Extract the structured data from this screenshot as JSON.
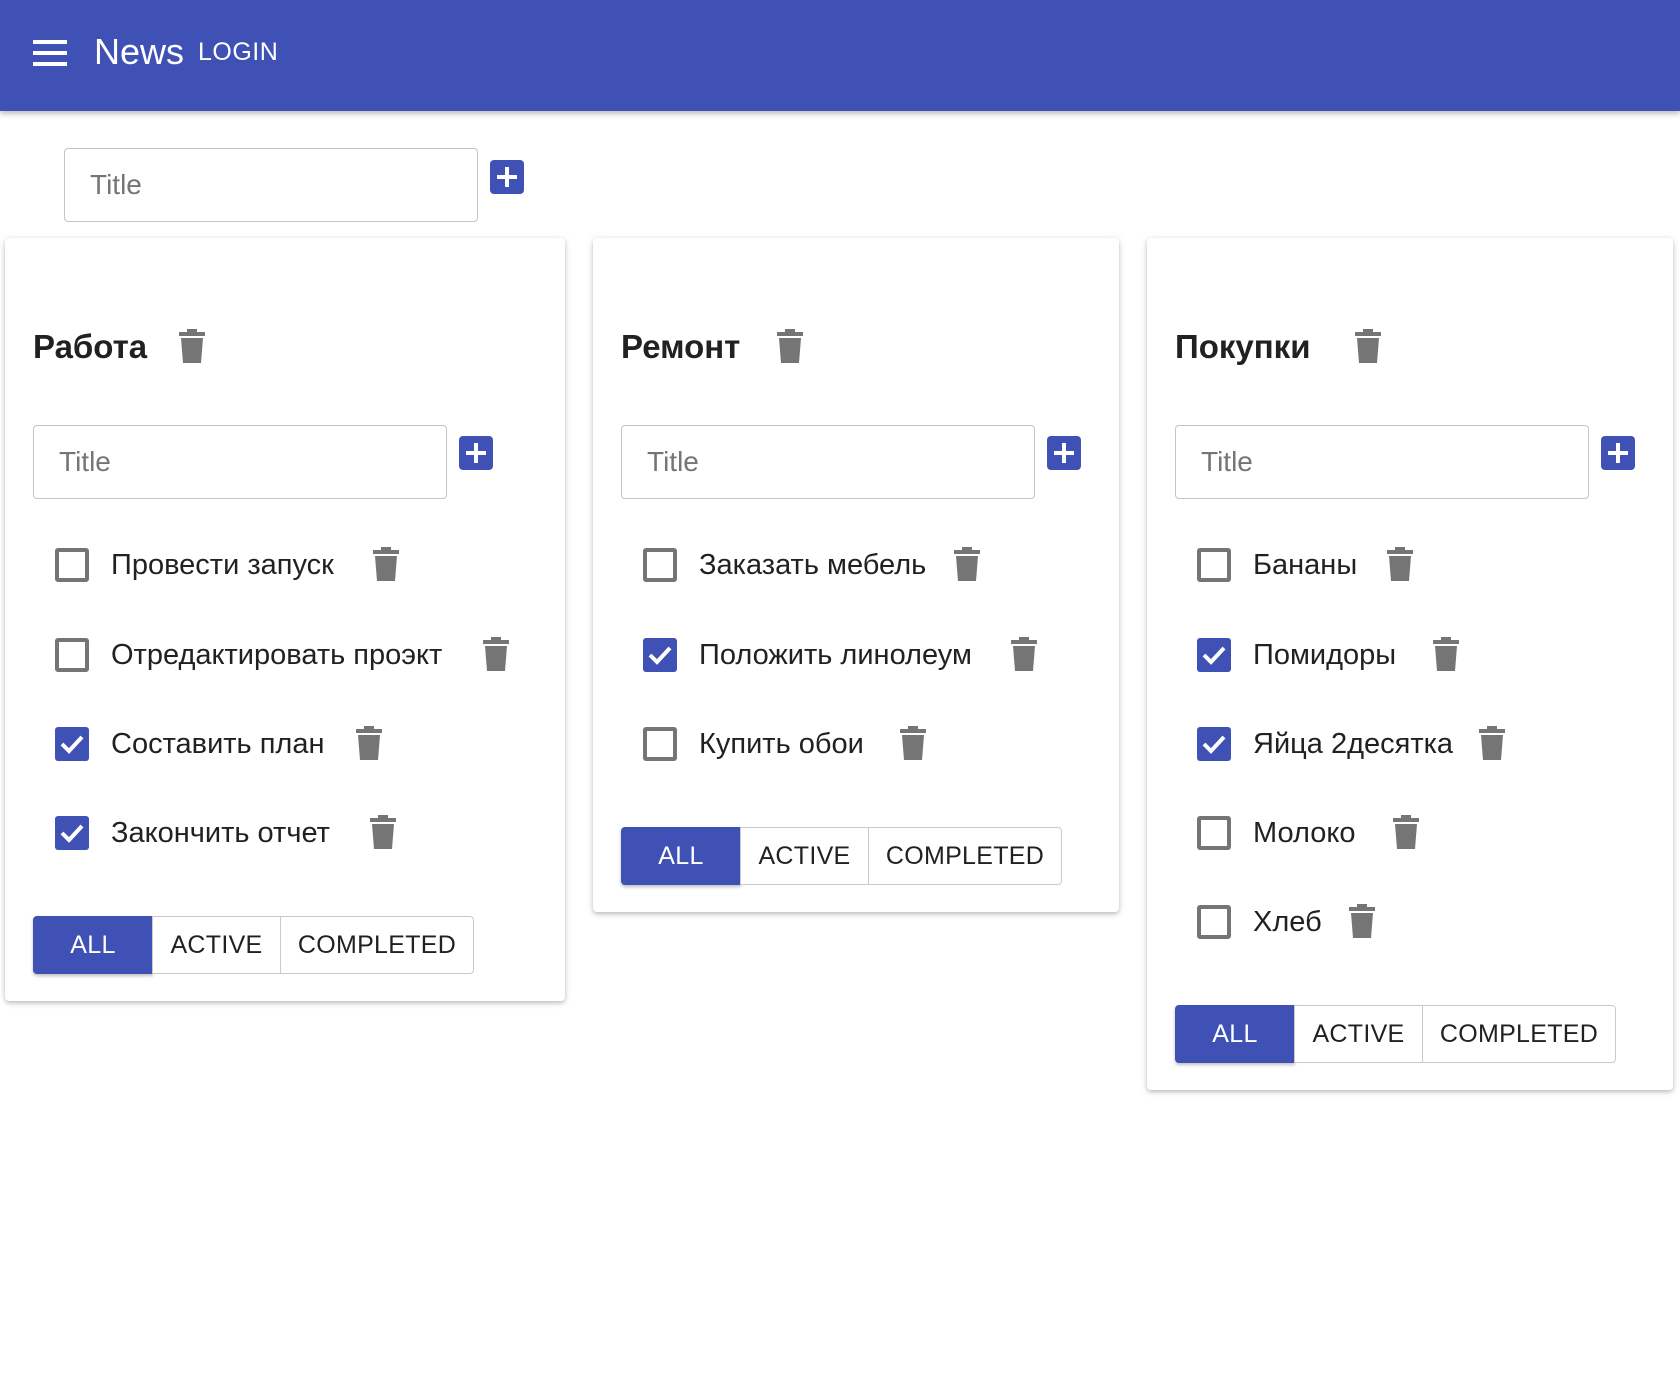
{
  "appbar": {
    "title": "News",
    "login_label": "LOGIN",
    "color": "#3f51b5"
  },
  "new_list": {
    "placeholder": "Title"
  },
  "lists": [
    {
      "title": "Работа",
      "placeholder": "Title",
      "tasks": [
        {
          "label": "Провести запуск",
          "done": false
        },
        {
          "label": "Отредактировать проэкт",
          "done": false
        },
        {
          "label": "Составить план",
          "done": true
        },
        {
          "label": "Закончить отчет",
          "done": true
        }
      ],
      "filters": {
        "all": "ALL",
        "active": "ACTIVE",
        "completed": "COMPLETED",
        "selected": "all"
      }
    },
    {
      "title": "Ремонт",
      "placeholder": "Title",
      "tasks": [
        {
          "label": "Заказать мебель",
          "done": false
        },
        {
          "label": "Положить линолеум",
          "done": true
        },
        {
          "label": "Купить обои",
          "done": false
        }
      ],
      "filters": {
        "all": "ALL",
        "active": "ACTIVE",
        "completed": "COMPLETED",
        "selected": "all"
      }
    },
    {
      "title": "Покупки",
      "placeholder": "Title",
      "tasks": [
        {
          "label": "Бананы",
          "done": false
        },
        {
          "label": "Помидоры",
          "done": true
        },
        {
          "label": "Яйца 2десятка",
          "done": true
        },
        {
          "label": "Молоко",
          "done": false
        },
        {
          "label": "Хлеб",
          "done": false
        }
      ],
      "filters": {
        "all": "ALL",
        "active": "ACTIVE",
        "completed": "COMPLETED",
        "selected": "all"
      }
    }
  ]
}
